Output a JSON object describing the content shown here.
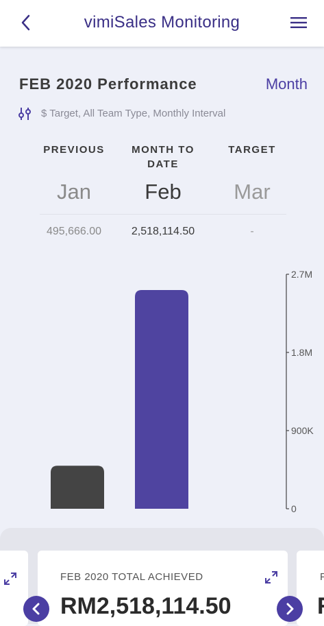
{
  "header": {
    "title": "vimiSales Monitoring",
    "back_icon": "chevron-left-icon",
    "menu_icon": "hamburger-menu-icon",
    "accent_color": "#3a2f86"
  },
  "performance": {
    "title": "FEB 2020 Performance",
    "period_toggle": "Month",
    "filter_icon": "sliders-icon",
    "filter_text": "$ Target, All Team Type, Monthly Interval"
  },
  "columns": [
    {
      "label": "PREVIOUS",
      "month": "Jan",
      "value": "495,666.00"
    },
    {
      "label": "MONTH TO DATE",
      "month": "Feb",
      "value": "2,518,114.50"
    },
    {
      "label": "TARGET",
      "month": "Mar",
      "value": "-"
    }
  ],
  "chart_data": {
    "type": "bar",
    "categories": [
      "Jan",
      "Feb"
    ],
    "values": [
      495666.0,
      2518114.5
    ],
    "colors": [
      "#444444",
      "#4f44a0"
    ],
    "y_ticks": [
      "0",
      "900K",
      "1.8M",
      "2.7M"
    ],
    "y_tick_values": [
      0,
      900000,
      1800000,
      2700000
    ],
    "ylim": [
      0,
      2700000
    ],
    "y_axis_position": "right"
  },
  "summary": {
    "card_label": "FEB 2020 TOTAL ACHIEVED",
    "card_value": "RM2,518,114.50",
    "expand_icon": "expand-arrows-icon",
    "prev_icon": "chevron-left-icon",
    "next_icon": "chevron-right-icon",
    "peek_label": "F",
    "peek_value": "R"
  }
}
